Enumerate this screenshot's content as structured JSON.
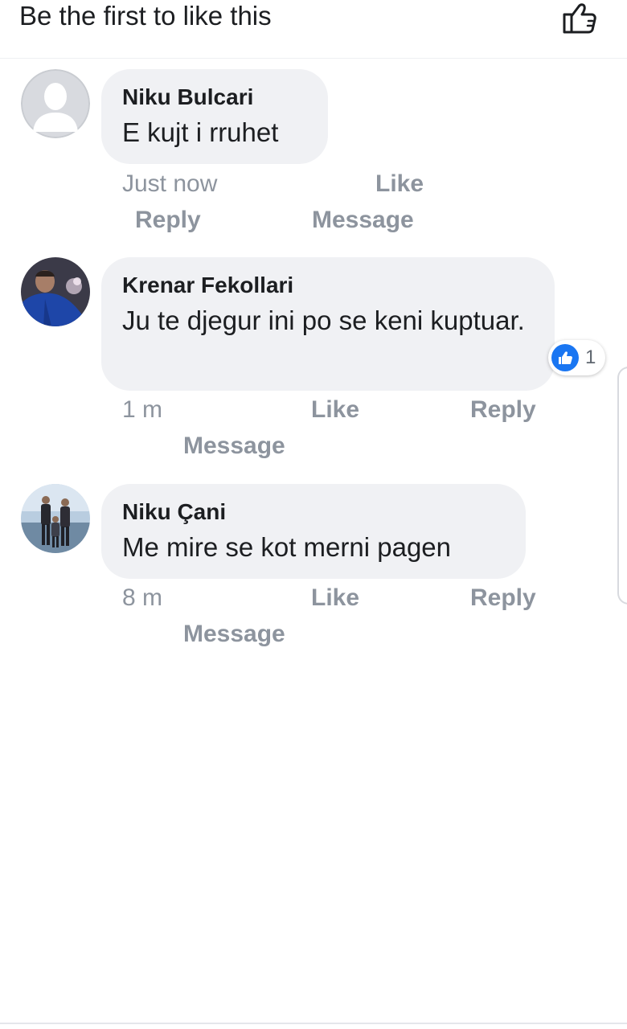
{
  "header": {
    "like_summary": "Be the first to like this",
    "like_icon": "thumbs-up-outline-icon"
  },
  "comments": [
    {
      "author": "Niku Bulcari",
      "text": "E kujt i rruhet",
      "time": "Just now",
      "actions": {
        "like": "Like",
        "reply": "Reply",
        "message": "Message"
      },
      "avatar": "default-profile-silhouette"
    },
    {
      "author": "Krenar Fekollari",
      "text": "Ju te djegur ini po se keni kuptuar.",
      "time": "1 m",
      "actions": {
        "like": "Like",
        "reply": "Reply",
        "message": "Message"
      },
      "avatar": "profile-photo-man-blue-jacket",
      "reactions": {
        "icon": "like-reaction-icon",
        "count": "1",
        "color": "#1a76f2"
      }
    },
    {
      "author": "Niku Çani",
      "text": "Me mire se kot merni pagen",
      "time": "8 m",
      "actions": {
        "like": "Like",
        "reply": "Reply",
        "message": "Message"
      },
      "avatar": "profile-photo-group-outdoors"
    }
  ],
  "colors": {
    "bubble": "#f0f1f4",
    "meta_text": "#8d949e",
    "primary_text": "#1c1e21",
    "accent": "#1a76f2"
  }
}
